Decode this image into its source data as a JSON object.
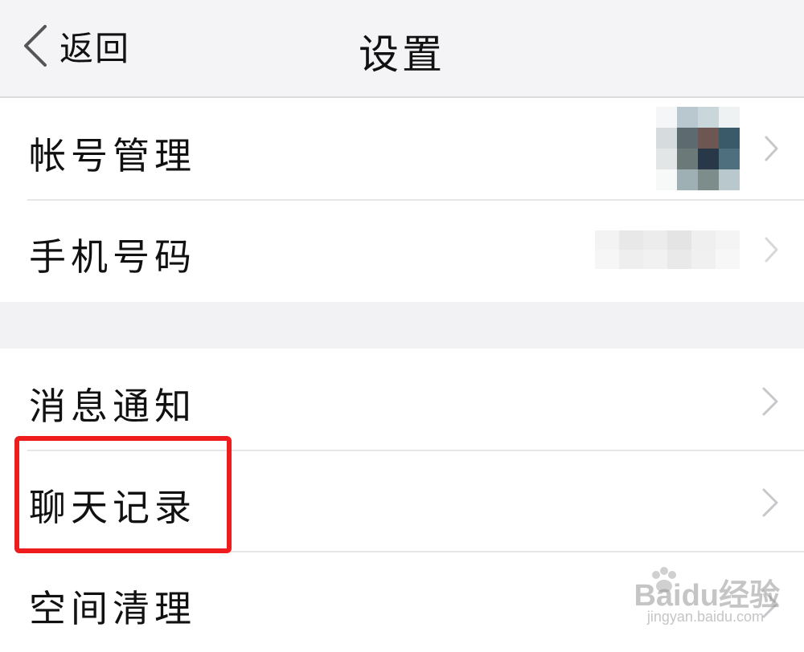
{
  "nav": {
    "back_label": "返回",
    "title": "设置"
  },
  "group_1": {
    "items": [
      {
        "label": "帐号管理",
        "value": "avatar (pixelated)"
      },
      {
        "label": "手机号码",
        "value": "phone number (pixelated)"
      }
    ]
  },
  "group_2": {
    "items": [
      {
        "label": "消息通知"
      },
      {
        "label": "聊天记录"
      },
      {
        "label": "空间清理"
      }
    ]
  },
  "annotation": {
    "highlight_item": "聊天记录",
    "color": "#ee1c1c"
  },
  "watermark": {
    "brand": "Baidu经验",
    "url": "jingyan.baidu.com"
  },
  "colors": {
    "background": "#f2f2f4",
    "row": "#ffffff",
    "text": "#111111",
    "chevron": "#c7c7cc"
  }
}
